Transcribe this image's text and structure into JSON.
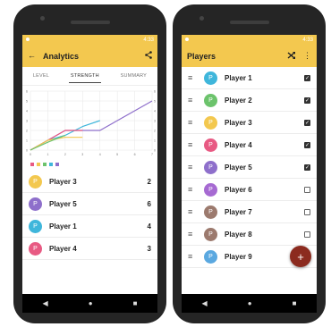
{
  "left": {
    "status_time": "4:33",
    "title": "Analytics",
    "icons": {
      "back": "back-arrow-icon",
      "share": "share-icon"
    },
    "tabs": [
      {
        "label": "LEVEL"
      },
      {
        "label": "STRENGTH"
      },
      {
        "label": "SUMMARY"
      }
    ],
    "rows": [
      {
        "initial": "P",
        "name": "Player 3",
        "score": "2",
        "color": "#f3c84f"
      },
      {
        "initial": "P",
        "name": "Player 5",
        "score": "6",
        "color": "#8e6fcb"
      },
      {
        "initial": "P",
        "name": "Player 1",
        "score": "4",
        "color": "#3fb6db"
      },
      {
        "initial": "P",
        "name": "Player 4",
        "score": "3",
        "color": "#e85a83"
      }
    ]
  },
  "right": {
    "status_time": "4:33",
    "title": "Players",
    "icons": {
      "shuffle": "shuffle-icon",
      "more": "more-vert-icon",
      "add": "add-icon"
    },
    "players": [
      {
        "initial": "P",
        "name": "Player 1",
        "color": "#3fb6db",
        "checked": true
      },
      {
        "initial": "P",
        "name": "Player 2",
        "color": "#6cc36c",
        "checked": true
      },
      {
        "initial": "P",
        "name": "Player 3",
        "color": "#f3c84f",
        "checked": true
      },
      {
        "initial": "P",
        "name": "Player 4",
        "color": "#e85a83",
        "checked": true
      },
      {
        "initial": "P",
        "name": "Player 5",
        "color": "#8e6fcb",
        "checked": true
      },
      {
        "initial": "P",
        "name": "Player 6",
        "color": "#a66ad2",
        "checked": false
      },
      {
        "initial": "P",
        "name": "Player 7",
        "color": "#9c7a6e",
        "checked": false
      },
      {
        "initial": "P",
        "name": "Player 8",
        "color": "#9c7a6e",
        "checked": false
      },
      {
        "initial": "P",
        "name": "Player 9",
        "color": "#5aa8e0",
        "checked": false
      }
    ],
    "fab_label": "+"
  },
  "nav": {
    "back": "◀",
    "home": "●",
    "recents": "■"
  },
  "chart_data": {
    "type": "line",
    "x": [
      0,
      1,
      2,
      3,
      4,
      5,
      6,
      7
    ],
    "x_ticks": [
      "0",
      "1",
      "2",
      "3",
      "4",
      "5",
      "6",
      "7"
    ],
    "y_ticks": [
      "0",
      "1",
      "2",
      "3",
      "4",
      "5",
      "6"
    ],
    "xlim": [
      0,
      7
    ],
    "ylim": [
      0,
      6
    ],
    "grid": true,
    "series": [
      {
        "color": "#8e6fcb",
        "points": [
          [
            0,
            0
          ],
          [
            1,
            1
          ],
          [
            2,
            2
          ],
          [
            3,
            2
          ],
          [
            4,
            2
          ],
          [
            5,
            3
          ],
          [
            6,
            4
          ],
          [
            7,
            5
          ]
        ]
      },
      {
        "color": "#3fb6db",
        "points": [
          [
            0,
            0
          ],
          [
            1,
            1
          ],
          [
            2,
            1.5
          ],
          [
            3,
            2.4
          ],
          [
            4,
            3
          ]
        ]
      },
      {
        "color": "#e85a83",
        "points": [
          [
            0,
            0
          ],
          [
            1,
            1
          ],
          [
            2,
            2
          ],
          [
            3,
            2
          ]
        ]
      },
      {
        "color": "#f3c84f",
        "points": [
          [
            0,
            0
          ],
          [
            1,
            1
          ],
          [
            2,
            1.3
          ],
          [
            3,
            1.3
          ]
        ]
      },
      {
        "color": "#6cc36c",
        "points": [
          [
            0,
            0
          ],
          [
            1,
            0.8
          ],
          [
            2,
            1.5
          ]
        ]
      }
    ],
    "legend_colors": [
      "#e85a83",
      "#f3c84f",
      "#6cc36c",
      "#3fb6db",
      "#8e6fcb"
    ]
  }
}
